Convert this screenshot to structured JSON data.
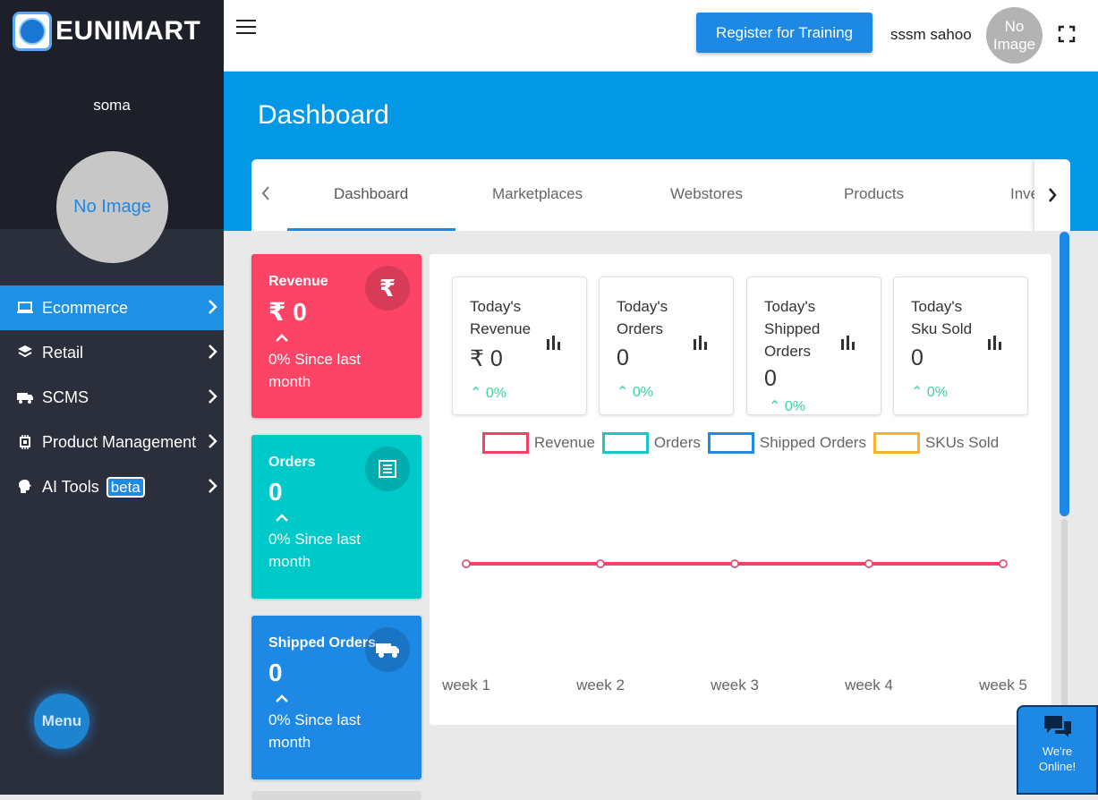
{
  "brand": {
    "name": "EUNIMART"
  },
  "sidebar": {
    "user_name": "soma",
    "avatar_text": "No Image",
    "items": [
      {
        "label": "Ecommerce",
        "icon": "laptop-icon",
        "active": true
      },
      {
        "label": "Retail",
        "icon": "layers-icon",
        "active": false
      },
      {
        "label": "SCMS",
        "icon": "truck-icon",
        "active": false
      },
      {
        "label": "Product Management",
        "icon": "chip-icon",
        "active": false
      },
      {
        "label": "AI Tools",
        "icon": "brain-icon",
        "active": false,
        "badge": "beta"
      }
    ],
    "menu_button": "Menu"
  },
  "header": {
    "register_button": "Register for Training",
    "user_name": "sssm sahoo",
    "avatar_text_line1": "No",
    "avatar_text_line2": "Image"
  },
  "page": {
    "title": "Dashboard"
  },
  "tabs": {
    "items": [
      "Dashboard",
      "Marketplaces",
      "Webstores",
      "Products",
      "Inve"
    ],
    "active": "Dashboard"
  },
  "kpis": {
    "revenue": {
      "title": "Revenue",
      "value": "₹ 0",
      "sub": "0% Since last month",
      "icon": "rupee-icon",
      "color": "#fc4566"
    },
    "orders": {
      "title": "Orders",
      "value": "0",
      "sub": "0% Since last month",
      "icon": "list-icon",
      "color": "#00c9ca"
    },
    "shipped": {
      "title": "Shipped Orders",
      "value": "0",
      "sub": "0% Since last month",
      "icon": "truck-icon",
      "color": "#1e88e5"
    }
  },
  "stats": [
    {
      "label": "Today's Revenue",
      "value": "₹ 0",
      "pct": "0%"
    },
    {
      "label": "Today's Orders",
      "value": "0",
      "pct": "0%"
    },
    {
      "label": "Today's Shipped Orders",
      "value": "0",
      "pct": "0%"
    },
    {
      "label": "Today's Sku Sold",
      "value": "0",
      "pct": "0%"
    }
  ],
  "chart_data": {
    "type": "line",
    "x": [
      "week  1",
      "week  2",
      "week  3",
      "week  4",
      "week  5"
    ],
    "series": [
      {
        "name": "Revenue",
        "values": [
          0,
          0,
          0,
          0,
          0
        ],
        "color": "#f0436a"
      },
      {
        "name": "Orders",
        "values": [
          0,
          0,
          0,
          0,
          0
        ],
        "color": "#1fc6c7"
      },
      {
        "name": "Shipped Orders",
        "values": [
          0,
          0,
          0,
          0,
          0
        ],
        "color": "#2688de"
      },
      {
        "name": "SKUs Sold",
        "values": [
          0,
          0,
          0,
          0,
          0
        ],
        "color": "#fbb02e"
      }
    ],
    "legend_position": "top",
    "grid": false
  },
  "chat": {
    "line1": "We're",
    "line2": "Online!"
  }
}
